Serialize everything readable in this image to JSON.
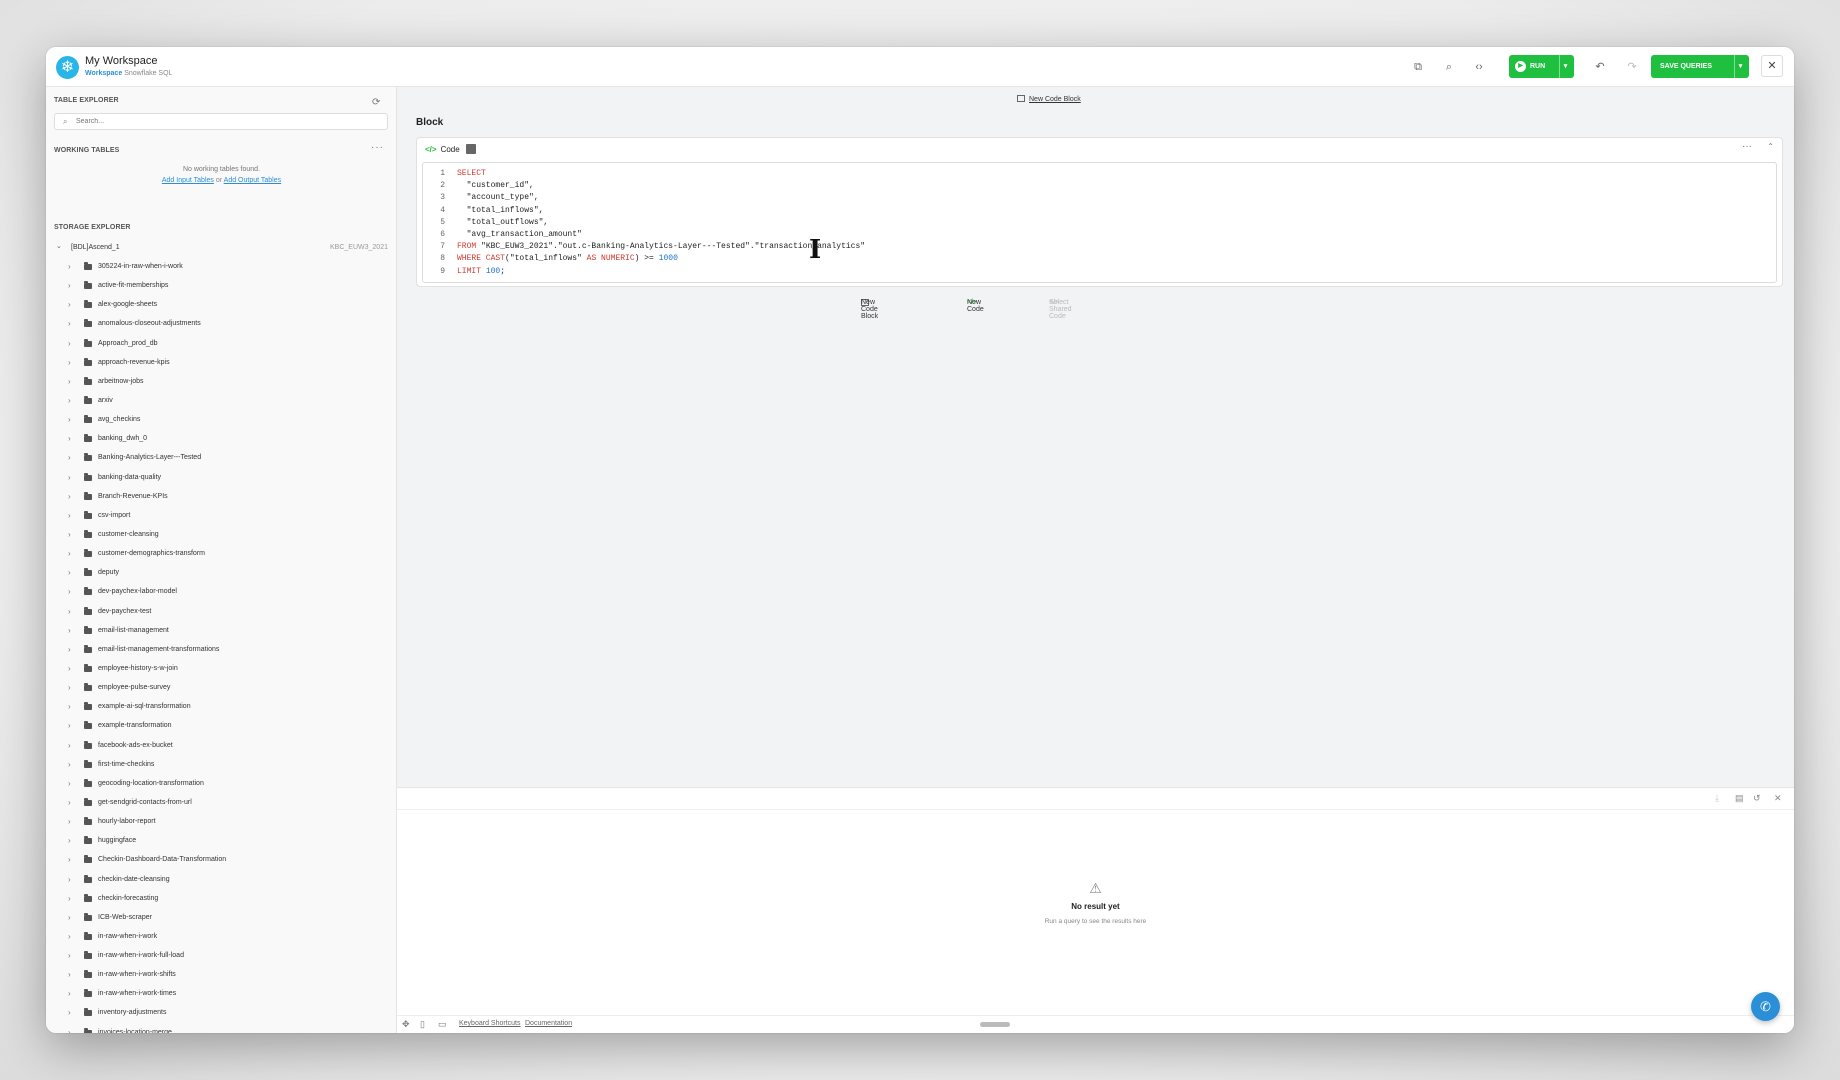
{
  "workspace": {
    "title": "My Workspace",
    "sub_label": "Workspace",
    "sub_kind": "Snowflake SQL",
    "logo_glyph": "❄"
  },
  "toolbar": {
    "run_label": "RUN",
    "save_label": "SAVE QUERIES",
    "icons": [
      "copy-icon",
      "search-icon",
      "braces-icon",
      "undo-icon",
      "redo-icon",
      "close-icon"
    ]
  },
  "sidebar": {
    "table_explorer_title": "TABLE EXPLORER",
    "search_placeholder": "Search...",
    "working_tables_title": "WORKING TABLES",
    "no_tables_msg": "No working tables found.",
    "add_input": "Add Input Tables",
    "or_text": "or",
    "add_output": "Add Output Tables",
    "storage_title": "STORAGE EXPLORER",
    "root_name": "[BDL]Ascend_1",
    "root_tag": "KBC_EUW3_2021",
    "items": [
      "305224-in-raw-when-i-work",
      "active-fit-memberships",
      "alex-google-sheets",
      "anomalous-closeout-adjustments",
      "Approach_prod_db",
      "approach-revenue-kpis",
      "arbeitnow-jobs",
      "arxiv",
      "avg_checkins",
      "banking_dwh_0",
      "Banking-Analytics-Layer---Tested",
      "banking-data-quality",
      "Branch-Revenue-KPIs",
      "csv-import",
      "customer-cleansing",
      "customer-demographics-transform",
      "deputy",
      "dev-paychex-labor-model",
      "dev-paychex-test",
      "email-list-management",
      "email-list-management-transformations",
      "employee-history-s-w-join",
      "employee-pulse-survey",
      "example-ai-sql-transformation",
      "example-transformation",
      "facebook-ads-ex-bucket",
      "first-time-checkins",
      "geocoding-location-transformation",
      "get-sendgrid-contacts-from-url",
      "hourly-labor-report",
      "huggingface",
      "Checkin-Dashboard-Data-Transformation",
      "checkin-date-cleansing",
      "checkin-forecasting",
      "ICB-Web-scraper",
      "in-raw-when-i-work",
      "in-raw-when-i-work-full-load",
      "in-raw-when-i-work-shifts",
      "in-raw-when-i-work-times",
      "inventory-adjustments",
      "invoices-location-merge"
    ]
  },
  "main": {
    "new_code_block_top": "New Code Block",
    "block_title": "Block",
    "code_tag": "Code",
    "code_lines": [
      {
        "n": "1",
        "parts": [
          {
            "t": "SELECT",
            "c": "kw"
          }
        ]
      },
      {
        "n": "2",
        "parts": [
          {
            "t": "  \"customer_id\",",
            "c": "str"
          }
        ]
      },
      {
        "n": "3",
        "parts": [
          {
            "t": "  \"account_type\",",
            "c": "str"
          }
        ]
      },
      {
        "n": "4",
        "parts": [
          {
            "t": "  \"total_inflows\",",
            "c": "str"
          }
        ]
      },
      {
        "n": "5",
        "parts": [
          {
            "t": "  \"total_outflows\",",
            "c": "str"
          }
        ]
      },
      {
        "n": "6",
        "parts": [
          {
            "t": "  \"avg_transaction_amount\"",
            "c": "str"
          }
        ]
      },
      {
        "n": "7",
        "parts": [
          {
            "t": "FROM ",
            "c": "kw"
          },
          {
            "t": "\"KBC_EUW3_2021\".\"out.c-Banking-Analytics-Layer---Tested\".\"transaction_analytics\"",
            "c": "str"
          }
        ]
      },
      {
        "n": "8",
        "parts": [
          {
            "t": "WHERE CAST",
            "c": "kw"
          },
          {
            "t": "(\"total_inflows\" ",
            "c": "str"
          },
          {
            "t": "AS NUMERIC",
            "c": "kw"
          },
          {
            "t": ") >= ",
            "c": "str"
          },
          {
            "t": "1000",
            "c": "num"
          }
        ]
      },
      {
        "n": "9",
        "parts": [
          {
            "t": "LIMIT ",
            "c": "kw"
          },
          {
            "t": "100",
            "c": "num"
          },
          {
            "t": ";",
            "c": "str"
          }
        ]
      }
    ],
    "new_code_block": "New Code Block",
    "new_code": "New Code",
    "select_shared": "Select Shared Code"
  },
  "results": {
    "title": "No result yet",
    "subtitle": "Run a query to see the results here"
  },
  "footer": {
    "shortcuts": "Keyboard Shortcuts",
    "docs": "Documentation"
  }
}
